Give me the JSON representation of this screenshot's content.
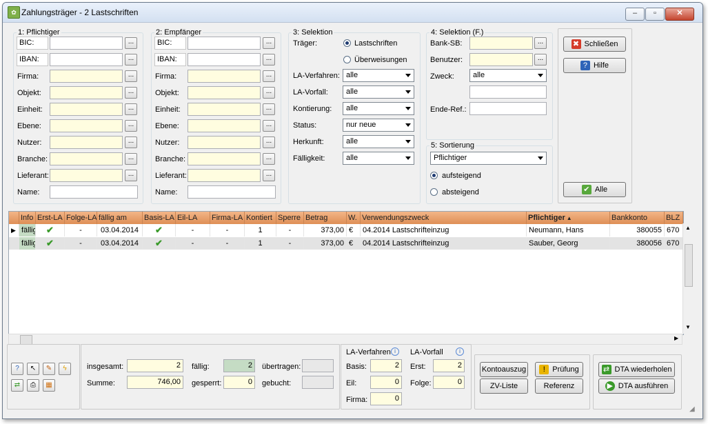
{
  "window": {
    "title": "Zahlungsträger - 2 Lastschriften",
    "min": "–",
    "max": "▫",
    "close": "✕"
  },
  "g1": {
    "legend": "1: Pflichtiger",
    "fields": [
      {
        "label": "BIC:",
        "value": ""
      },
      {
        "label": "IBAN:",
        "value": ""
      },
      {
        "label": "Firma:",
        "value": ""
      },
      {
        "label": "Objekt:",
        "value": ""
      },
      {
        "label": "Einheit:",
        "value": ""
      },
      {
        "label": "Ebene:",
        "value": ""
      },
      {
        "label": "Nutzer:",
        "value": ""
      },
      {
        "label": "Branche:",
        "value": ""
      },
      {
        "label": "Lieferant:",
        "value": ""
      },
      {
        "label": "Name:",
        "value": ""
      }
    ]
  },
  "g2": {
    "legend": "2: Empfänger",
    "fields": [
      {
        "label": "BIC:",
        "value": ""
      },
      {
        "label": "IBAN:",
        "value": ""
      },
      {
        "label": "Firma:",
        "value": ""
      },
      {
        "label": "Objekt:",
        "value": ""
      },
      {
        "label": "Einheit:",
        "value": ""
      },
      {
        "label": "Ebene:",
        "value": ""
      },
      {
        "label": "Nutzer:",
        "value": ""
      },
      {
        "label": "Branche:",
        "value": ""
      },
      {
        "label": "Lieferant:",
        "value": ""
      },
      {
        "label": "Name:",
        "value": ""
      }
    ]
  },
  "dots": "...",
  "g3": {
    "legend": "3: Selektion",
    "traeger_label": "Träger:",
    "radio_last": "Lastschriften",
    "radio_ueber": "Überweisungen",
    "selects": [
      {
        "label": "LA-Verfahren:",
        "value": "alle"
      },
      {
        "label": "LA-Vorfall:",
        "value": "alle"
      },
      {
        "label": "Kontierung:",
        "value": "alle"
      },
      {
        "label": "Status:",
        "value": "nur neue"
      },
      {
        "label": "Herkunft:",
        "value": "alle"
      },
      {
        "label": "Fälligkeit:",
        "value": "alle"
      }
    ]
  },
  "g4": {
    "legend": "4: Selektion (F.)",
    "banksb": "Bank-SB:",
    "benutzer": "Benutzer:",
    "zweck": "Zweck:",
    "zweck_value": "alle",
    "enderef": "Ende-Ref.:"
  },
  "g5": {
    "legend": "5: Sortierung",
    "value": "Pflichtiger",
    "auf": "aufsteigend",
    "ab": "absteigend"
  },
  "buttons": {
    "schliessen": "Schließen",
    "hilfe": "Hilfe",
    "alle": "Alle"
  },
  "grid": {
    "columns": [
      "Info",
      "Erst-LA",
      "Folge-LA",
      "fällig am",
      "Basis-LA",
      "Eil-LA",
      "Firma-LA",
      "Kontiert",
      "Sperre",
      "Betrag",
      "W.",
      "Verwendungszweck",
      "Pflichtiger",
      "Bankkonto",
      "BLZ"
    ],
    "rows": [
      {
        "info": "fällig",
        "folge": "-",
        "faellig": "03.04.2014",
        "eil": "-",
        "firma": "-",
        "kontiert": "1",
        "sperre": "-",
        "betrag": "373,00",
        "w": "€",
        "zweck": "04.2014 Lastschrifteinzug",
        "pflichtiger": "Neumann, Hans",
        "konto": "380055",
        "blz": "670"
      },
      {
        "info": "fällig",
        "folge": "-",
        "faellig": "03.04.2014",
        "eil": "-",
        "firma": "-",
        "kontiert": "1",
        "sperre": "-",
        "betrag": "373,00",
        "w": "€",
        "zweck": "04.2014 Lastschrifteinzug",
        "pflichtiger": "Sauber, Georg",
        "konto": "380056",
        "blz": "670"
      }
    ]
  },
  "summary": {
    "insgesamt_label": "insgesamt:",
    "insgesamt": "2",
    "summe_label": "Summe:",
    "summe": "746,00",
    "faellig_label": "fällig:",
    "faellig": "2",
    "gesperrt_label": "gesperrt:",
    "gesperrt": "0",
    "uebertragen_label": "übertragen:",
    "uebertragen": "",
    "gebucht_label": "gebucht:",
    "gebucht": ""
  },
  "la": {
    "verfahren_title": "LA-Verfahren",
    "vorfall_title": "LA-Vorfall",
    "basis_label": "Basis:",
    "basis": "2",
    "eil_label": "Eil:",
    "eil": "0",
    "firma_label": "Firma:",
    "firma": "0",
    "erst_label": "Erst:",
    "erst": "2",
    "folge_label": "Folge:",
    "folge": "0"
  },
  "actions": {
    "kontoauszug": "Kontoauszug",
    "pruefung": "Prüfung",
    "zvliste": "ZV-Liste",
    "referenz": "Referenz",
    "dta_wiederholen": "DTA wiederholen",
    "dta_ausfuehren": "DTA ausführen"
  }
}
